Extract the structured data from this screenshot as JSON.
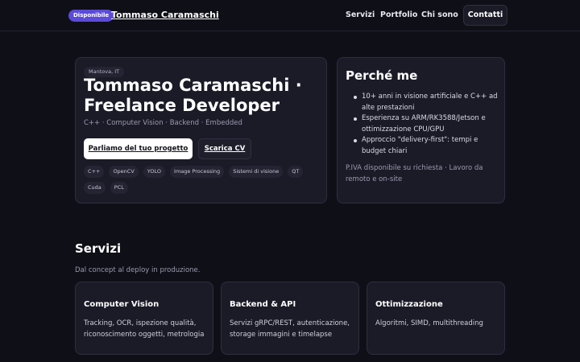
{
  "header": {
    "badge": "Disponibile",
    "brand": "Tommaso Caramaschi",
    "nav": [
      "Servizi",
      "Portfolio",
      "Chi sono"
    ],
    "contact": "Contatti"
  },
  "hero": {
    "location": "Mantova, IT",
    "title": "Tommaso Caramaschi · Freelance Developer",
    "subtitle": "C++ · Computer Vision · Backend · Embedded",
    "primary_cta": "Parliamo del tuo progetto",
    "secondary_cta": "Scarica CV",
    "tags": [
      "C++",
      "OpenCV",
      "YOLO",
      "Image Processing",
      "Sistemi di visione",
      "QT",
      "Cuda",
      "PCL"
    ]
  },
  "why": {
    "title": "Perché me",
    "points": [
      "10+ anni in visione artificiale e C++ ad alte prestazioni",
      "Esperienza su ARM/RK3588/Jetson e ottimizzazione CPU/GPU",
      "Approccio \"delivery-first\": tempi e budget chiari"
    ],
    "note": "P.IVA disponibile su richiesta · Lavoro da remoto e on-site"
  },
  "services": {
    "title": "Servizi",
    "subtitle": "Dal concept al deploy in produzione.",
    "items": [
      {
        "title": "Computer Vision",
        "desc": "Tracking, OCR, ispezione qualità, riconoscimento oggetti, metrologia"
      },
      {
        "title": "Backend & API",
        "desc": "Servizi gRPC/REST, autenticazione, storage immagini e timelapse"
      },
      {
        "title": "Ottimizzazione",
        "desc": "Algoritmi, SIMD, multithreading"
      }
    ]
  }
}
